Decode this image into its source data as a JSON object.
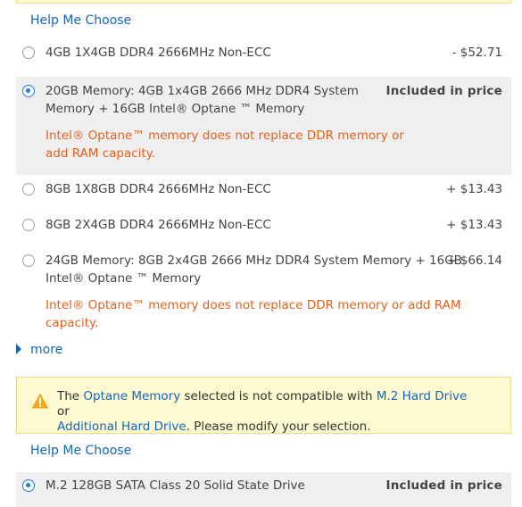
{
  "top_help": "Help Me Choose",
  "memory_options": [
    {
      "label_lines": [
        "4GB 1X4GB DDR4 2666MHz Non-ECC"
      ],
      "price": "- $52.71",
      "selected": false
    },
    {
      "label_lines": [
        "20GB Memory: 4GB 1x4GB 2666 MHz DDR4 System",
        "Memory + 16GB Intel® Optane ™ Memory"
      ],
      "note_lines": [
        "Intel® Optane™ memory does not replace DDR memory or",
        "add RAM capacity."
      ],
      "price": "Included in price",
      "selected": true
    },
    {
      "label_lines": [
        "8GB 1X8GB DDR4 2666MHz Non-ECC"
      ],
      "price": "+ $13.43",
      "selected": false
    },
    {
      "label_lines": [
        "8GB 2X4GB DDR4 2666MHz Non-ECC"
      ],
      "price": "+ $13.43",
      "selected": false
    },
    {
      "label_lines": [
        "24GB Memory: 8GB 2x4GB 2666 MHz DDR4 System Memory + 16GB",
        "Intel® Optane ™ Memory"
      ],
      "note_lines": [
        "Intel® Optane™ memory does not replace DDR memory or add RAM",
        "capacity."
      ],
      "price": "+ $66.14",
      "selected": false
    }
  ],
  "more_label": "more",
  "warning": {
    "prefix": "The ",
    "link1": "Optane Memory",
    "middle": " selected is not compatible with ",
    "link2": "M.2 Hard Drive",
    "or": " or",
    "link3": "Additional Hard Drive",
    "suffix": ". Please modify your selection.",
    "icon": "warning-triangle-icon",
    "icon_color": "#f0a81c"
  },
  "storage_help": "Help Me Choose",
  "storage_option": {
    "label": "M.2 128GB SATA Class 20 Solid State Drive",
    "price": "Included in price",
    "selected": true
  },
  "colors": {
    "link": "#1666b8",
    "note": "#e4611c",
    "radio_selected": "#1a7ee6",
    "selected_bg": "#efefef",
    "warning_bg": "#fdf9d0"
  }
}
